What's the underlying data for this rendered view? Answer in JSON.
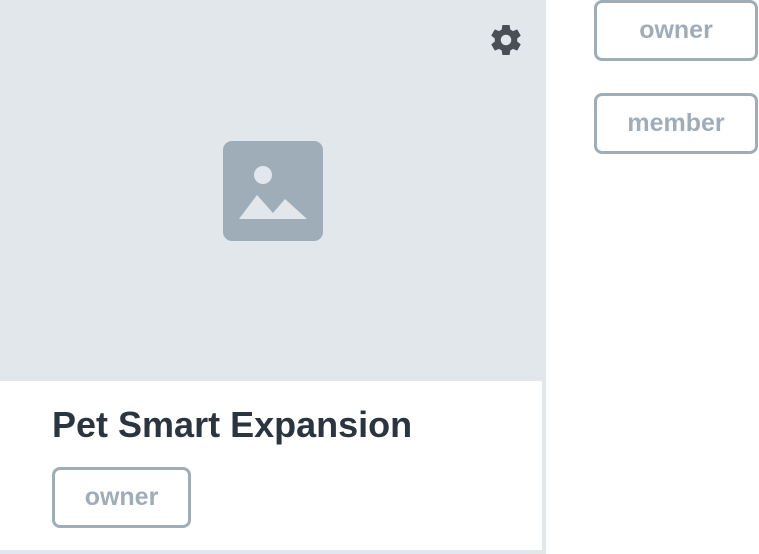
{
  "card": {
    "title": "Pet Smart Expansion",
    "role_badge": "owner",
    "settings_icon": "gear-icon",
    "placeholder_icon": "image-placeholder-icon"
  },
  "role_options": [
    {
      "label": "owner"
    },
    {
      "label": "member"
    }
  ],
  "colors": {
    "media_background": "#e2e7ec",
    "icon_gray": "#9fadb9",
    "gear": "#4a4f55",
    "title_text": "#2a3540",
    "badge_border": "#9fadb9"
  }
}
